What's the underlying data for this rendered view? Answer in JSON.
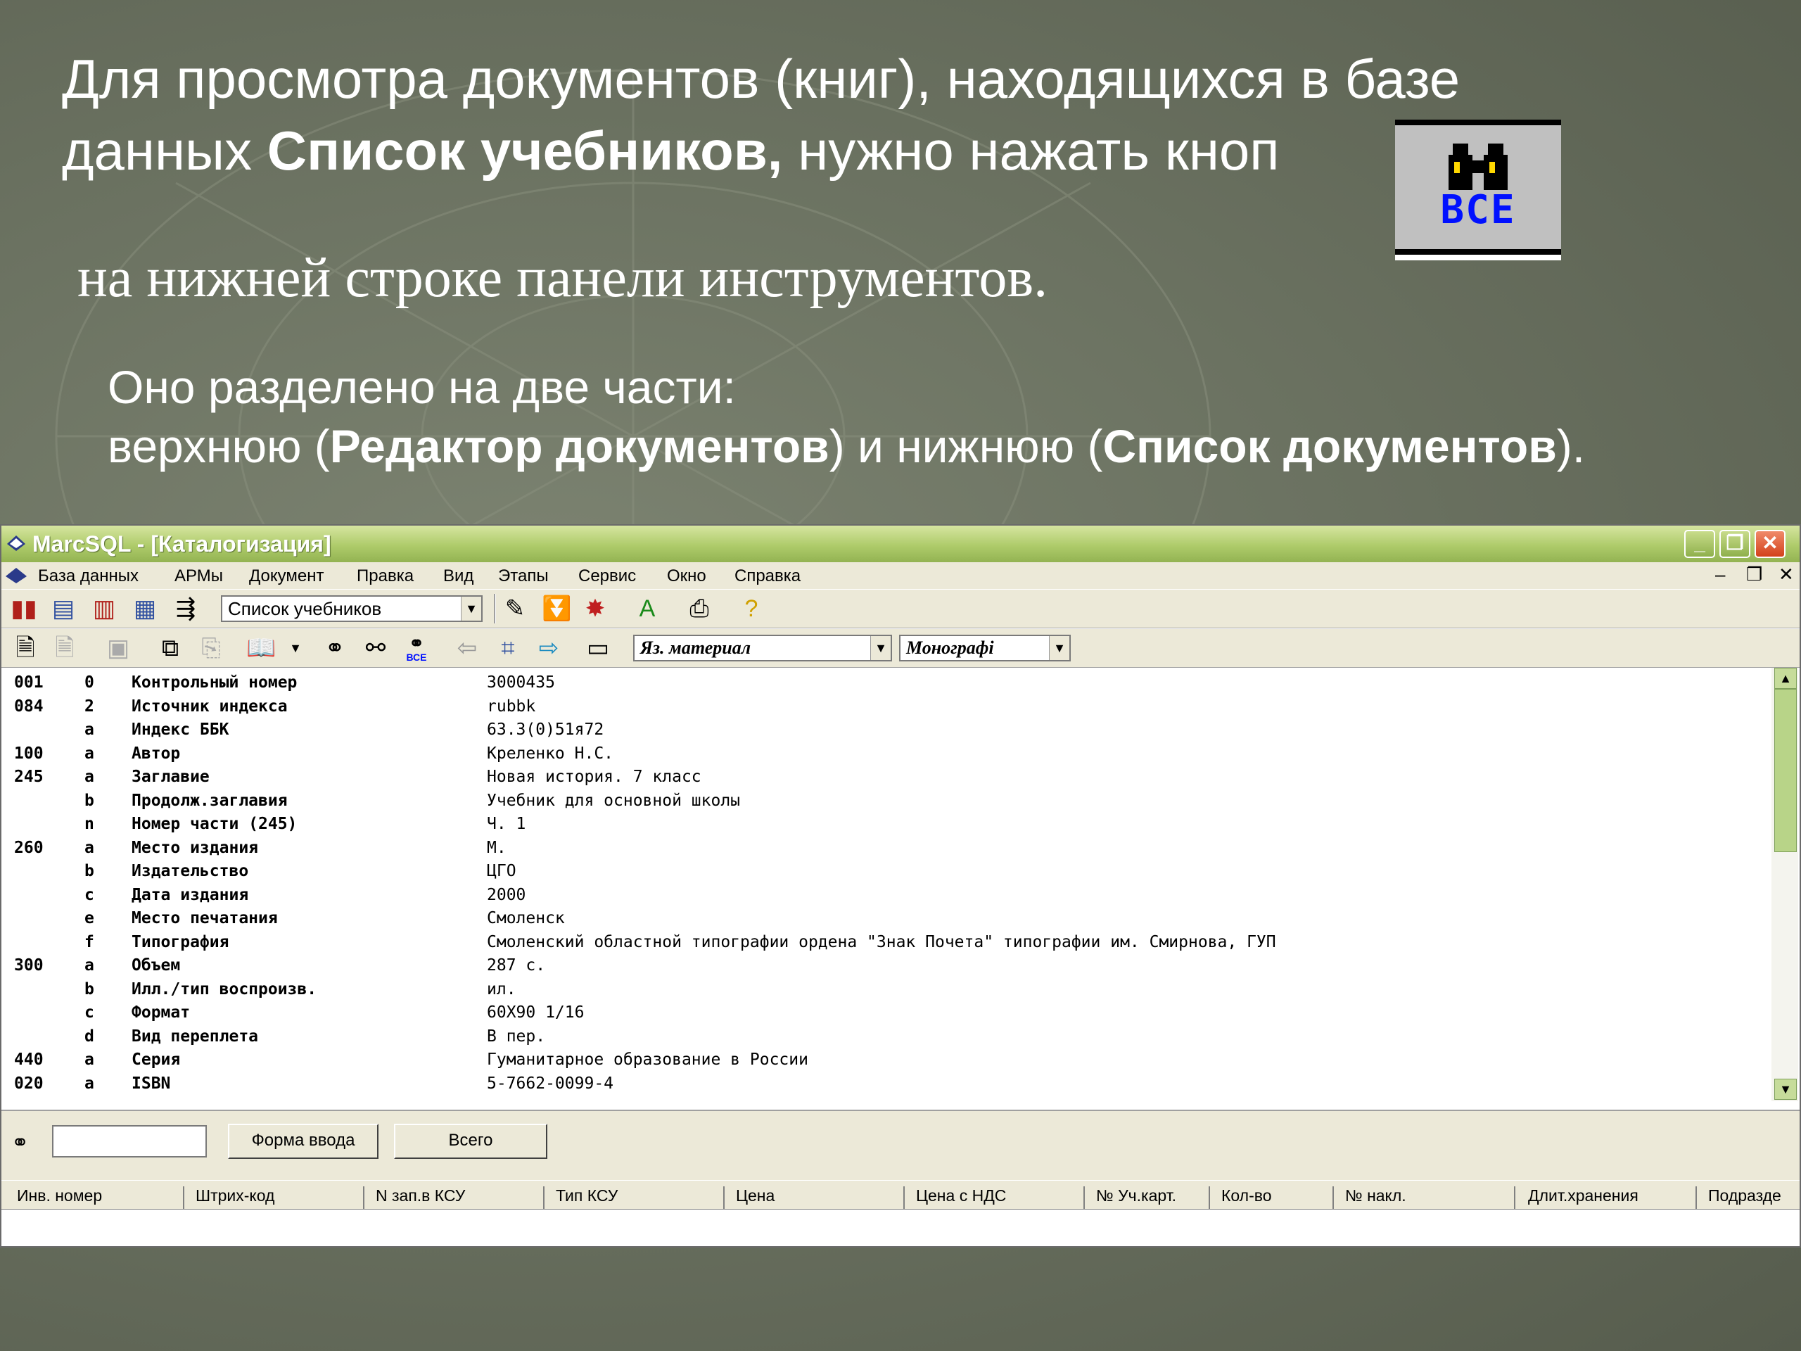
{
  "slide": {
    "line1": "Для просмотра документов (книг), находящихся в базе",
    "line2_pre": "данных ",
    "line2_bold": "Список учебников,",
    "line2_post": " нужно нажать кноп",
    "line3": "на нижней строке панели инструментов.",
    "line4": "Оно разделено на две части:",
    "line5_pre": "верхнюю (",
    "line5_bold1": "Редактор документов",
    "line5_mid": ") и нижнюю (",
    "line5_bold2": "Список документов",
    "line5_post": ").",
    "button_label": "ВСЕ"
  },
  "window": {
    "title": "MarcSQL - [Каталогизация]",
    "controls": {
      "minimize": "_",
      "maximize": "❐",
      "close": "✕"
    }
  },
  "menu": {
    "items": [
      "База данных",
      "АРМы",
      "Документ",
      "Правка",
      "Вид",
      "Этапы",
      "Сервис",
      "Окно",
      "Справка"
    ],
    "mdi": {
      "minimize": "–",
      "restore": "❐",
      "close": "✕"
    }
  },
  "toolbar": {
    "database_select": "Список учебников",
    "language_select": "Яз. материал",
    "type_select": "Монографі",
    "vse_label": "ВСЕ"
  },
  "editor": {
    "rows": [
      {
        "tag": "001",
        "sub": "0",
        "name": "Контрольный номер",
        "value": "3000435"
      },
      {
        "tag": "084",
        "sub": "2",
        "name": "Источник индекса",
        "value": "rubbk"
      },
      {
        "tag": "",
        "sub": "a",
        "name": "Индекс ББК",
        "value": "63.3(0)51я72"
      },
      {
        "tag": "100",
        "sub": "a",
        "name": "Автор",
        "value": "Креленко Н.С."
      },
      {
        "tag": "245",
        "sub": "a",
        "name": "Заглавие",
        "value": "Новая история. 7 класс"
      },
      {
        "tag": "",
        "sub": "b",
        "name": "Продолж.заглавия",
        "value": "Учебник для основной школы"
      },
      {
        "tag": "",
        "sub": "n",
        "name": "Номер части (245)",
        "value": "Ч. 1"
      },
      {
        "tag": "260",
        "sub": "a",
        "name": "Место издания",
        "value": "М."
      },
      {
        "tag": "",
        "sub": "b",
        "name": "Издательство",
        "value": "ЦГО"
      },
      {
        "tag": "",
        "sub": "c",
        "name": "Дата издания",
        "value": "2000"
      },
      {
        "tag": "",
        "sub": "e",
        "name": "Место печатания",
        "value": "Смоленск"
      },
      {
        "tag": "",
        "sub": "f",
        "name": "Типография",
        "value": "Смоленский областной типографии  ордена \"Знак Почета\" типографии им. Смирнова, ГУП"
      },
      {
        "tag": "300",
        "sub": "a",
        "name": "Объем",
        "value": "287 с."
      },
      {
        "tag": "",
        "sub": "b",
        "name": "Илл./тип воспроизв.",
        "value": "ил."
      },
      {
        "tag": "",
        "sub": "c",
        "name": "Формат",
        "value": "60X90 1/16"
      },
      {
        "tag": "",
        "sub": "d",
        "name": "Вид переплета",
        "value": "В пер."
      },
      {
        "tag": "440",
        "sub": "a",
        "name": "Серия",
        "value": "Гуманитарное образование в России"
      },
      {
        "tag": "020",
        "sub": "a",
        "name": "ISBN",
        "value": "5-7662-0099-4"
      }
    ]
  },
  "lower": {
    "form_button": "Форма ввода",
    "total_button": "Всего",
    "columns": [
      "Инв. номер",
      "Штрих-код",
      "N зап.в КСУ",
      "Тип КСУ",
      "Цена",
      "Цена с НДС",
      "№ Уч.карт.",
      "Кол-во",
      "№ накл.",
      "Длит.хранения",
      "Подразде"
    ]
  },
  "colors": {
    "background": "#6b7261",
    "titlebar": "#aecb6a",
    "accent_blue": "#0010ff"
  }
}
